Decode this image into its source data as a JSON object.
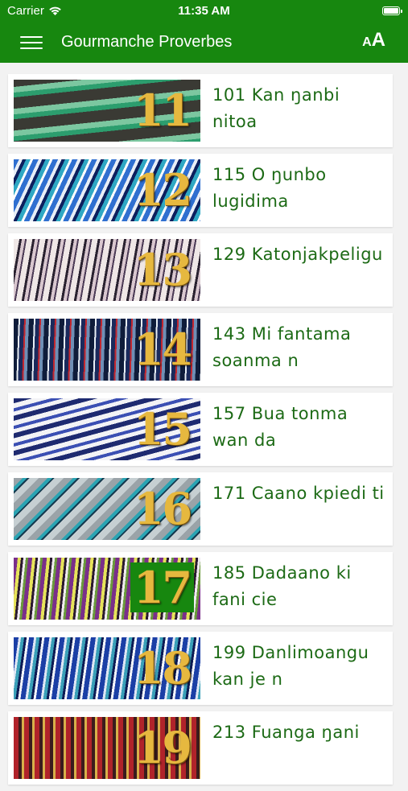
{
  "status": {
    "carrier": "Carrier",
    "time": "11:35 AM"
  },
  "header": {
    "title": "Gourmanche Proverbes",
    "font_size_small": "A",
    "font_size_big": "A"
  },
  "items": [
    {
      "number": "11",
      "title": "101 Kan ŋanbi nitoa"
    },
    {
      "number": "12",
      "title": "115 O ŋunbo lugidima"
    },
    {
      "number": "13",
      "title": "129 Katonjakpeligu"
    },
    {
      "number": "14",
      "title": "143 Mi fantama soanma n"
    },
    {
      "number": "15",
      "title": "157 Bua tonma wan da"
    },
    {
      "number": "16",
      "title": "171 Caano kpiedi ti"
    },
    {
      "number": "17",
      "title": "185 Dadaano ki fani cie"
    },
    {
      "number": "18",
      "title": "199 Danlimoangu kan je n"
    },
    {
      "number": "19",
      "title": "213 Fuanga ŋani"
    }
  ],
  "colors": {
    "brand_green": "#17870f",
    "title_green": "#1c6a15",
    "number_gold": "#e6b83f"
  }
}
